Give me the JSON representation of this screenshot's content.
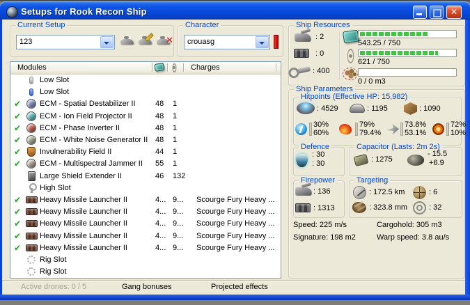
{
  "window": {
    "title": "Setups for Rook Recon Ship"
  },
  "icons": {
    "fitted_check": "✔",
    "close_glyph": "✕"
  },
  "colors": {
    "accent_blue": "#0046D5",
    "titlebar_blue": "#0C53E6",
    "bar_green": "#3FC53F",
    "alert_red": "#CC1010"
  },
  "current_setup": {
    "label": "Current Setup",
    "value": "123"
  },
  "character": {
    "label": "Character",
    "value": "crouasg"
  },
  "ship_resources": {
    "label": "Ship Resources",
    "turret_hardpoints": ": 2",
    "launcher_hardpoints": ": 0",
    "calibration": ": 400",
    "cpu": {
      "text": "543.25 / 750",
      "pct": 72
    },
    "powergrid": {
      "text": "621 / 750",
      "pct": 83
    },
    "dronebay": {
      "text": "0 / 0 m3",
      "pct": 0
    }
  },
  "modules": {
    "headers": {
      "modules": "Modules",
      "charges": "Charges"
    },
    "rows": [
      {
        "fitted": false,
        "icon": "slot-gray",
        "name": "Low Slot",
        "cpu": "",
        "qty": "",
        "charge": ""
      },
      {
        "fitted": false,
        "icon": "slot-blue",
        "name": "Low Slot",
        "cpu": "",
        "qty": "",
        "charge": ""
      },
      {
        "fitted": true,
        "icon": "ecm-spatial",
        "name": "ECM - Spatial Destabilizer II",
        "cpu": "48",
        "qty": "1",
        "charge": ""
      },
      {
        "fitted": true,
        "icon": "ecm-ion",
        "name": "ECM - Ion Field Projector II",
        "cpu": "48",
        "qty": "1",
        "charge": ""
      },
      {
        "fitted": true,
        "icon": "ecm-phase",
        "name": "ECM - Phase Inverter II",
        "cpu": "48",
        "qty": "1",
        "charge": ""
      },
      {
        "fitted": true,
        "icon": "ecm-noise",
        "name": "ECM - White Noise Generator II",
        "cpu": "48",
        "qty": "1",
        "charge": ""
      },
      {
        "fitted": true,
        "icon": "invuln",
        "name": "Invulnerability Field II",
        "cpu": "44",
        "qty": "1",
        "charge": ""
      },
      {
        "fitted": true,
        "icon": "ecm-multi",
        "name": "ECM - Multispectral Jammer II",
        "cpu": "55",
        "qty": "1",
        "charge": ""
      },
      {
        "fitted": false,
        "icon": "shield-ext",
        "name": "Large Shield Extender II",
        "cpu": "46",
        "qty": "132",
        "charge": ""
      },
      {
        "fitted": false,
        "icon": "high-slot",
        "name": "High Slot",
        "cpu": "",
        "qty": "",
        "charge": ""
      },
      {
        "fitted": true,
        "icon": "launcher",
        "name": "Heavy Missile Launcher II",
        "cpu": "4...",
        "qty": "9...",
        "charge": "Scourge Fury Heavy ..."
      },
      {
        "fitted": true,
        "icon": "launcher",
        "name": "Heavy Missile Launcher II",
        "cpu": "4...",
        "qty": "9...",
        "charge": "Scourge Fury Heavy ..."
      },
      {
        "fitted": true,
        "icon": "launcher",
        "name": "Heavy Missile Launcher II",
        "cpu": "4...",
        "qty": "9...",
        "charge": "Scourge Fury Heavy ..."
      },
      {
        "fitted": true,
        "icon": "launcher",
        "name": "Heavy Missile Launcher II",
        "cpu": "4...",
        "qty": "9...",
        "charge": "Scourge Fury Heavy ..."
      },
      {
        "fitted": true,
        "icon": "launcher",
        "name": "Heavy Missile Launcher II",
        "cpu": "4...",
        "qty": "9...",
        "charge": "Scourge Fury Heavy ..."
      },
      {
        "fitted": false,
        "icon": "rig",
        "name": "Rig Slot",
        "cpu": "",
        "qty": "",
        "charge": ""
      },
      {
        "fitted": false,
        "icon": "rig",
        "name": "Rig Slot",
        "cpu": "",
        "qty": "",
        "charge": ""
      }
    ]
  },
  "ship_parameters": {
    "label": "Ship Parameters",
    "hitpoints": {
      "label": "Hitpoints (Effective HP: 15,982)",
      "shield": ": 4529",
      "armor": ": 1195",
      "structure": ": 1090",
      "resists": [
        {
          "type": "em",
          "top": "30%",
          "bottom": "60%"
        },
        {
          "type": "thermal",
          "top": "79%",
          "bottom": "79.4%"
        },
        {
          "type": "kinetic",
          "top": "73.8%",
          "bottom": "53.1%"
        },
        {
          "type": "explosive",
          "top": "72%",
          "bottom": "10%"
        }
      ]
    },
    "defence": {
      "label": "Defence",
      "line1": ": 30",
      "line2": ": 30"
    },
    "capacitor": {
      "label": "Capacitor (Lasts: 2m 2s)",
      "amount": ": 1275",
      "drain": "- 15.5",
      "recharge": "+6.9"
    },
    "firepower": {
      "label": "Firepower",
      "dps": ": 136",
      "volley": ": 1313"
    },
    "targeting": {
      "label": "Targeting",
      "range": ": 172.5 km",
      "scan_resolution": ": 323.8 mm",
      "max_targets": ": 6",
      "sensor_strength": ": 32"
    },
    "stats": {
      "speed": "Speed: 225 m/s",
      "cargohold": "Cargohold: 305 m3",
      "signature": "Signature: 198 m2",
      "warp_speed": "Warp speed: 3.8 au/s"
    }
  },
  "status_bar": {
    "active_drones": "Active drones: 0 / 5",
    "gang_bonuses": "Gang bonuses",
    "projected_effects": "Projected effects"
  }
}
